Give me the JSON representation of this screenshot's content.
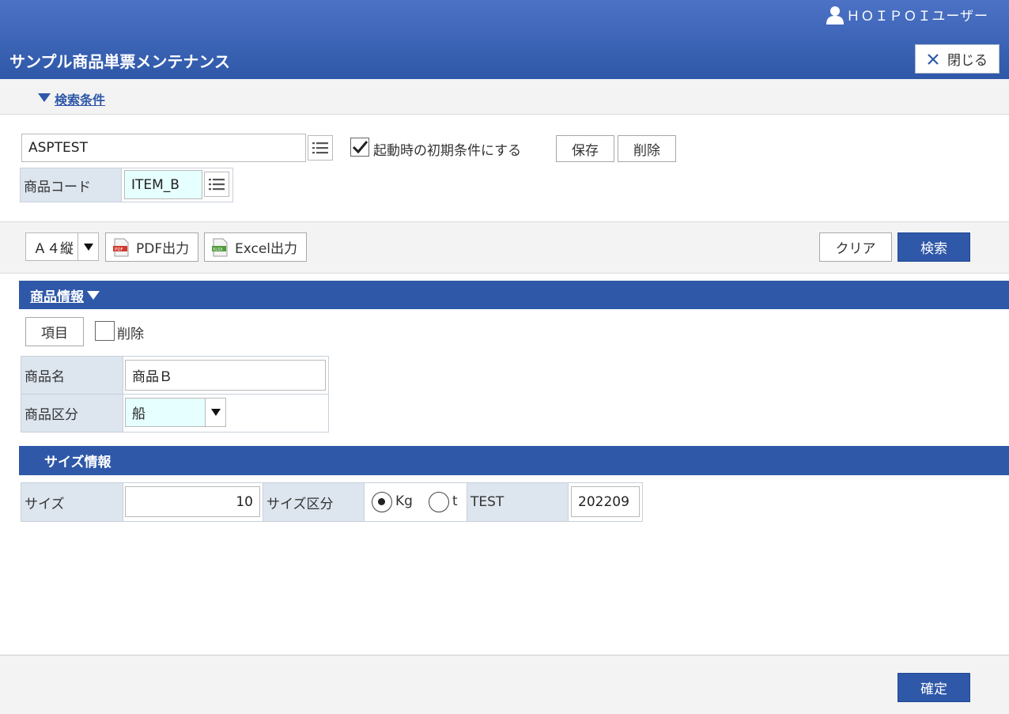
{
  "header": {
    "user_name": "ＨＯＩＰＯＩユーザー",
    "title": "サンプル商品単票メンテナンス",
    "close_label": "閉じる"
  },
  "search": {
    "toggle_label": "検索条件",
    "condition_value": "ASPTEST",
    "default_checkbox_label": "起動時の初期条件にする",
    "default_checked": true,
    "save_label": "保存",
    "delete_label": "削除",
    "item_code_label": "商品コード",
    "item_code_value": "ITEM_B"
  },
  "toolbar": {
    "paper_select": "Ａ４縦",
    "pdf_label": "PDF出力",
    "excel_label": "Excel出力",
    "clear_label": "クリア",
    "search_label": "検索"
  },
  "product_section": {
    "title": "商品情報",
    "item_button": "項目",
    "delete_checkbox_label": "削除",
    "name_label": "商品名",
    "name_value": "商品Ｂ",
    "type_label": "商品区分",
    "type_value": "船"
  },
  "size_section": {
    "title": "サイズ情報",
    "size_label": "サイズ",
    "size_value": "10",
    "size_type_label": "サイズ区分",
    "radio_kg": "Kg",
    "radio_t": "t",
    "selected_unit": "Kg",
    "test_label": "TEST",
    "test_value": "202209"
  },
  "footer": {
    "confirm_label": "確定"
  },
  "colors": {
    "brand": "#2f58a8",
    "label_bg": "#dde5ef",
    "highlight_input": "#e6ffff"
  },
  "icons": [
    "user-icon",
    "close-icon",
    "list-icon",
    "pdf-icon",
    "excel-icon",
    "triangle-down-icon"
  ]
}
